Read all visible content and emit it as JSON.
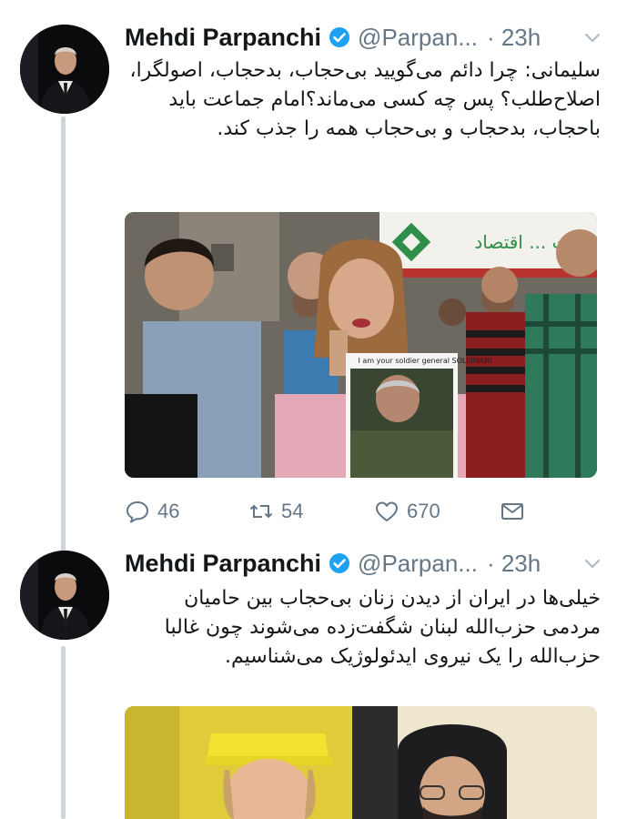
{
  "tweets": [
    {
      "author_name": "Mehdi Parpanchi",
      "handle": "@Parpan...",
      "time": "· 23h",
      "text": "سلیمانی: چرا دائم می‌گویید بی‌حجاب، بدحجاب، اصولگرا، اصلاح‌طلب؟ پس چه کسی می‌ماند؟امام جماعت باید باحجاب، بدحجاب و بی‌حجاب همه را جذب کند.",
      "media_caption": "I am your soldier general SOLEIMANI",
      "media_sign": "صادرات ... اقتصاد",
      "replies": "46",
      "retweets": "54",
      "likes": "670"
    },
    {
      "author_name": "Mehdi Parpanchi",
      "handle": "@Parpan...",
      "time": "· 23h",
      "text": "خیلی‌ها در ایران از دیدن زنان بی‌حجاب بین حامیان مردمی حزب‌الله لبنان شگفت‌زده می‌شوند چون غالبا حزب‌الله را یک نیروی ایدئولوژیک می‌شناسیم."
    }
  ],
  "icons": {
    "verified": "verified-badge-icon",
    "more": "chevron-down-icon",
    "reply": "reply-icon",
    "retweet": "retweet-icon",
    "like": "heart-icon",
    "dm": "envelope-icon"
  },
  "colors": {
    "verified": "#1da1f2",
    "muted": "#657786",
    "thread_line": "#ccd6dd"
  }
}
